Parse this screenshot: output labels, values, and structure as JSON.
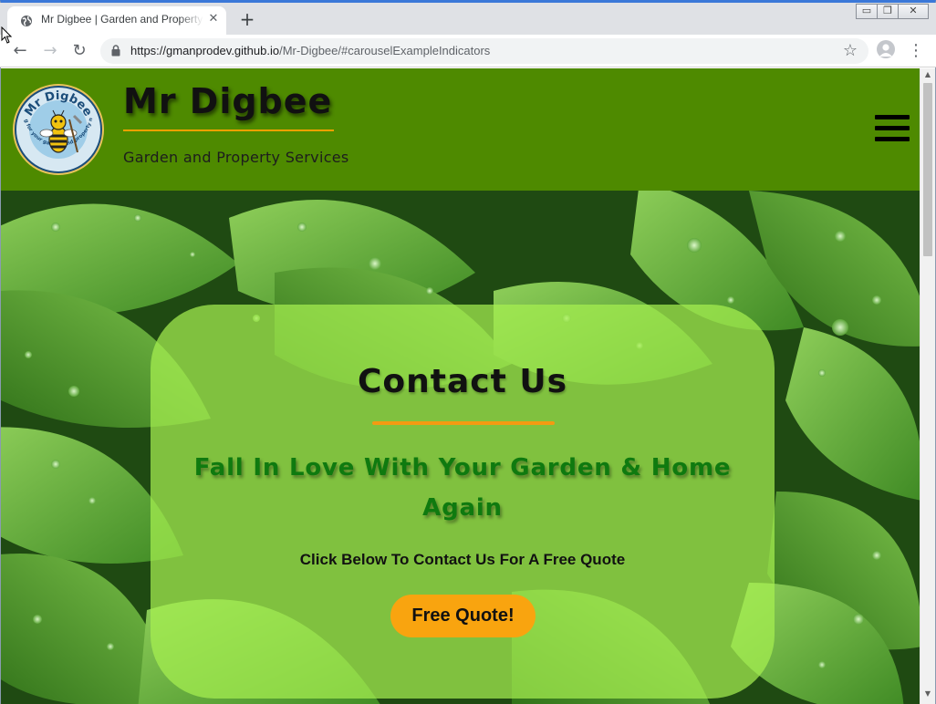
{
  "browser": {
    "tab": {
      "title": "Mr Digbee | Garden and Property Services",
      "close_glyph": "✕",
      "favicon": "globe-icon"
    },
    "new_tab_glyph": "+",
    "window_controls": {
      "minimize": "▭",
      "restore": "❐",
      "close": "✕"
    },
    "nav": {
      "back": "←",
      "forward": "→",
      "reload": "↻"
    },
    "address": {
      "host": "https://gmanprodev.github.io",
      "path": "/Mr-Digbee/#carouselExampleIndicators"
    },
    "bookmark_glyph": "☆",
    "menu_glyph": "⋮"
  },
  "site": {
    "header": {
      "title": "Mr Digbee",
      "tagline": "Garden and Property Services",
      "logo": {
        "top_text": "Mr Digbee",
        "ring_text": "Caring for your garden and property needs"
      }
    },
    "hero": {
      "heading": "Contact Us",
      "subheading": "Fall In Love With Your Garden & Home Again",
      "text": "Click Below To Contact Us For A Free Quote",
      "button_label": "Free Quote!"
    }
  },
  "colors": {
    "header_bg": "#4e8a00",
    "accent_orange": "#f39a12",
    "button_orange": "#f9a40f",
    "subheading_green": "#0f7a0f",
    "card_green": "#a6f050"
  }
}
